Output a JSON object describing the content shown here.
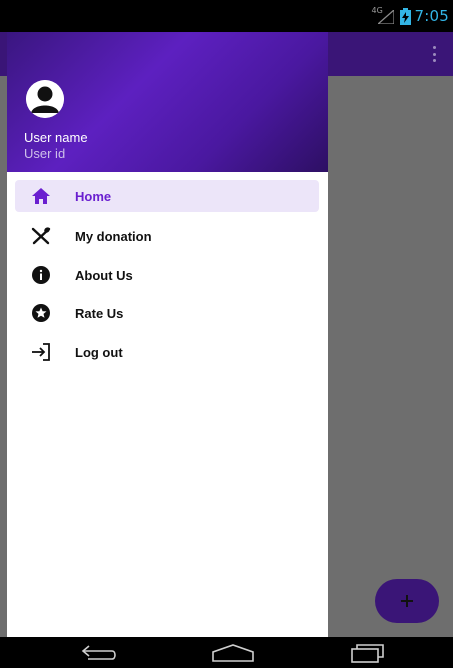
{
  "status_bar": {
    "network_tag": "4G",
    "time": "7:05"
  },
  "drawer": {
    "header": {
      "user_name": "User name",
      "user_id": "User id"
    },
    "items": [
      {
        "label": "Home",
        "icon": "home-icon",
        "active": true
      },
      {
        "label": "My donation",
        "icon": "utensils-icon",
        "active": false
      },
      {
        "label": "About Us",
        "icon": "info-icon",
        "active": false
      },
      {
        "label": "Rate Us",
        "icon": "star-icon",
        "active": false
      },
      {
        "label": "Log out",
        "icon": "logout-icon",
        "active": false
      }
    ]
  },
  "colors": {
    "primary": "#3a1577",
    "accent": "#6a1fd0",
    "active_item_bg": "#ece5f9",
    "status_accent": "#33b5e5"
  }
}
